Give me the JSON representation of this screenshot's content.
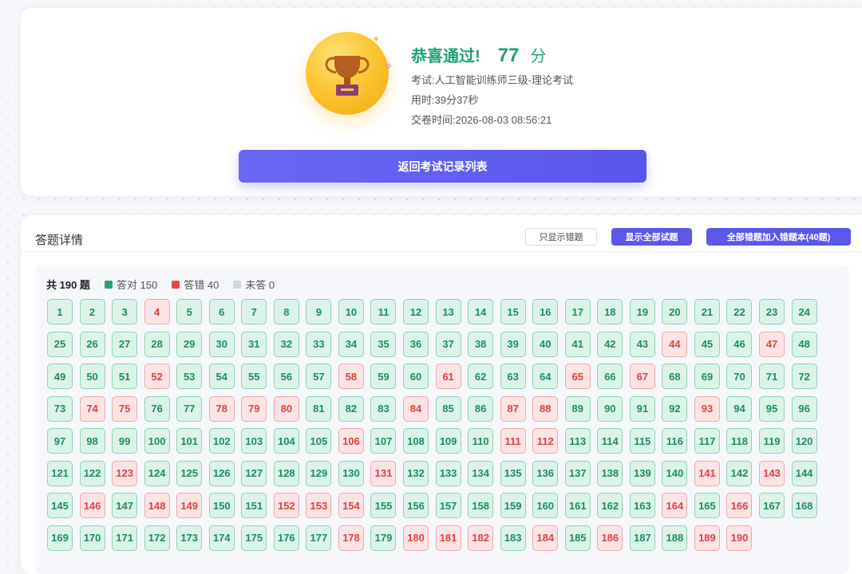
{
  "result": {
    "pass_text": "恭喜通过!",
    "score": "77",
    "score_unit": "分",
    "exam": "考试:人工智能训练师三级-理论考试",
    "duration": "用时:39分37秒",
    "submit_time": "交卷时间:2026-08-03 08:56:21"
  },
  "actions": {
    "back_label": "返回考试记录列表"
  },
  "detail": {
    "title": "答题详情",
    "show_wrong_label": "只显示错题",
    "show_all_label": "显示全部试题",
    "add_wrong_label": "全部错题加入错题本(40题)"
  },
  "legend": {
    "total": "共 190 题",
    "correct": "答对 150",
    "wrong": "答错 40",
    "unanswered": "未答 0"
  },
  "colors": {
    "correct": "#1fa971",
    "wrong": "#e54848",
    "unanswered": "#cfd6e3",
    "accent": "#5b58ea"
  },
  "questions": {
    "total": 190,
    "wrong": [
      4,
      44,
      47,
      52,
      58,
      61,
      65,
      67,
      74,
      75,
      78,
      79,
      80,
      84,
      87,
      88,
      93,
      106,
      111,
      112,
      123,
      131,
      141,
      143,
      146,
      148,
      149,
      152,
      153,
      154,
      164,
      166,
      178,
      180,
      181,
      182,
      184,
      186,
      189,
      190
    ]
  }
}
